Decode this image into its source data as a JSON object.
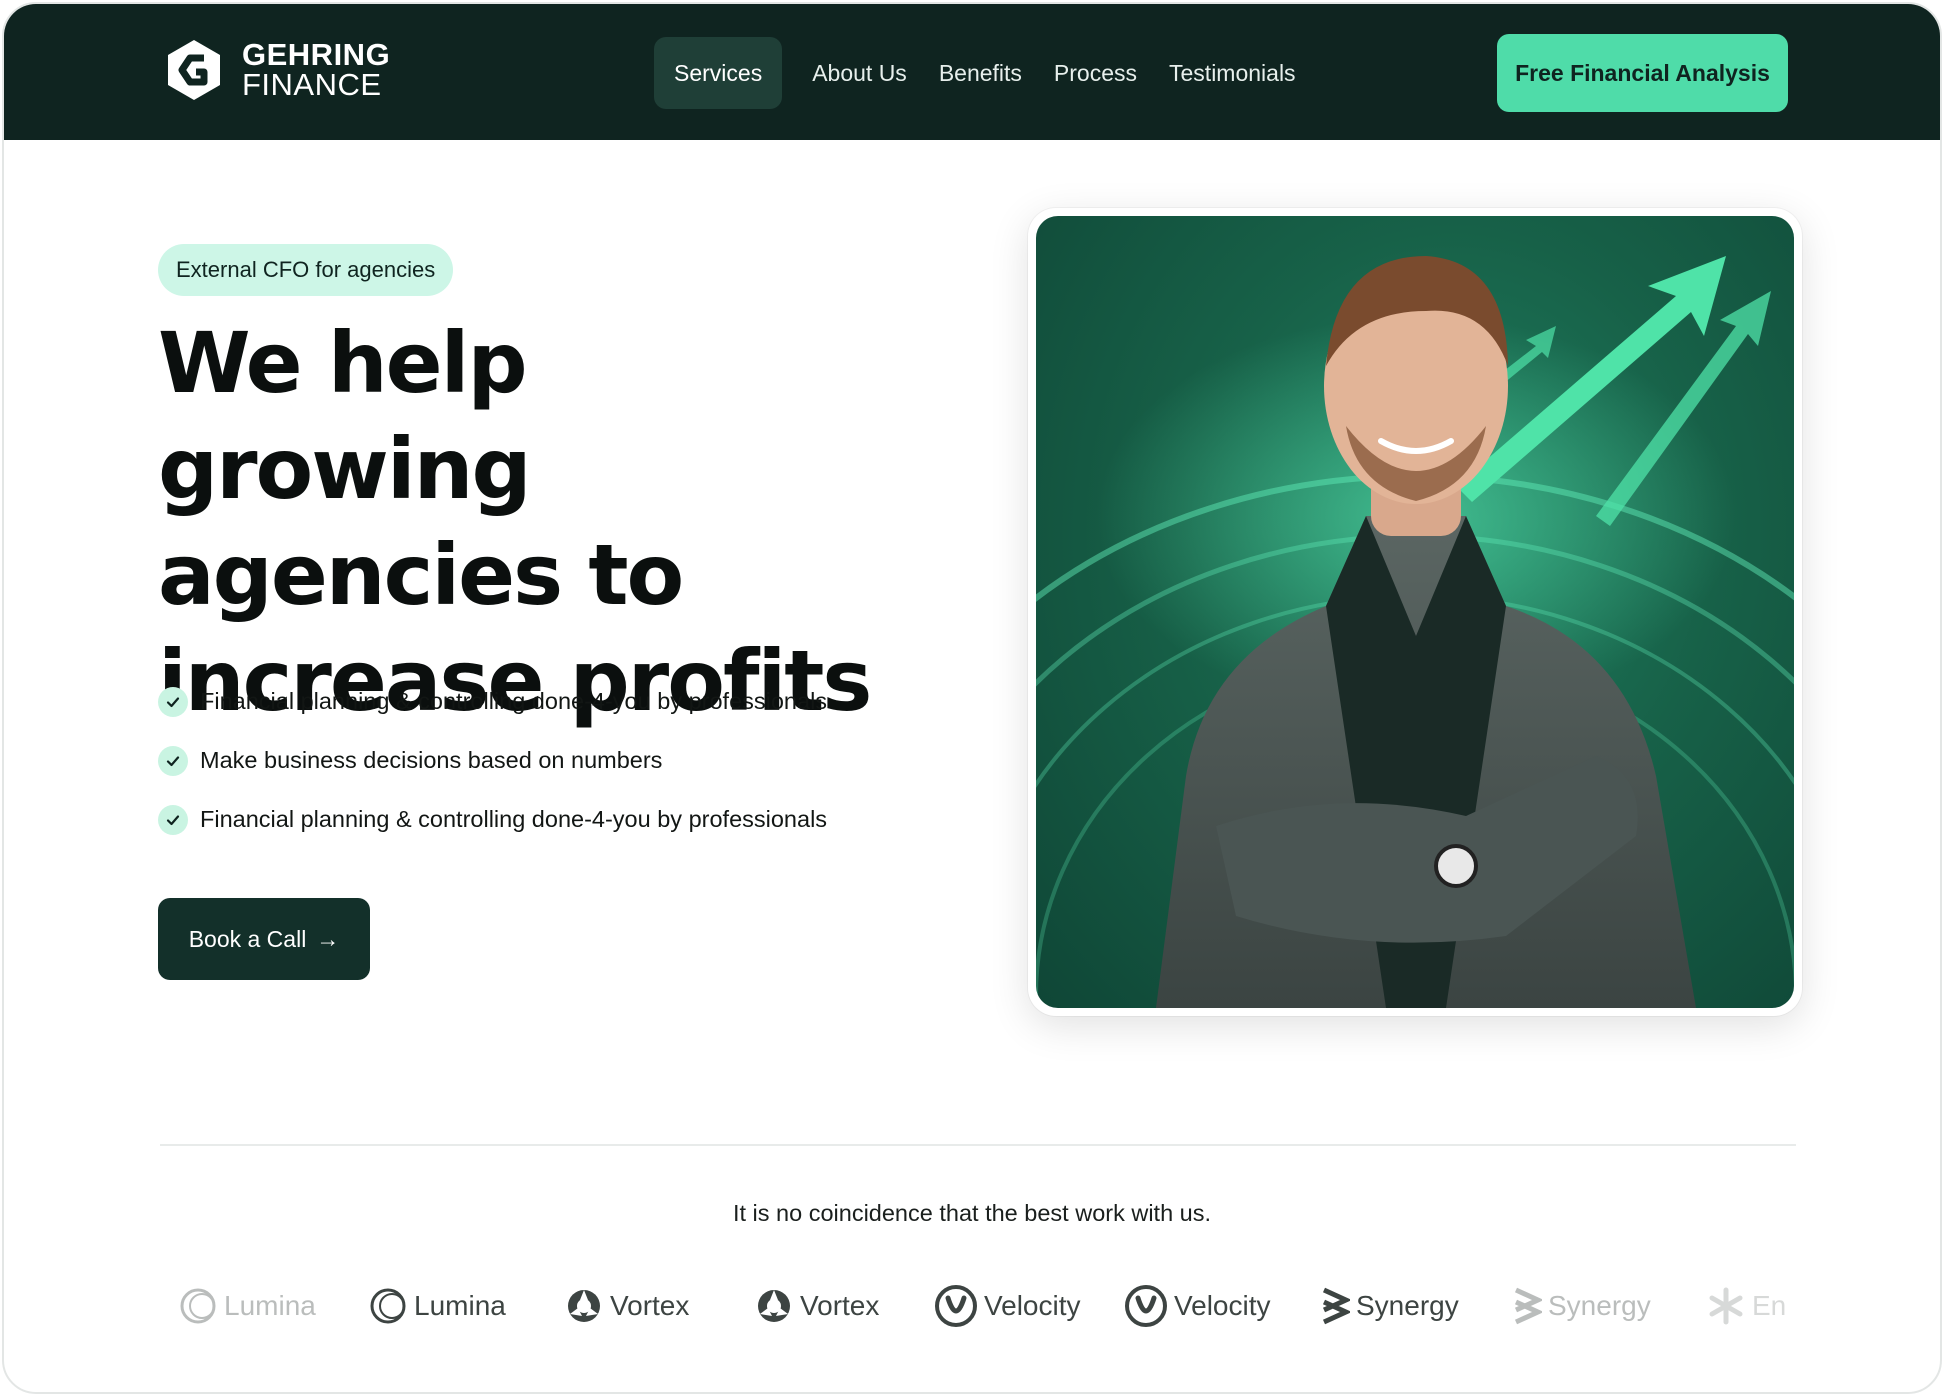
{
  "brand": {
    "name_line1": "GEHRING",
    "name_line2": "FINANCE"
  },
  "nav": {
    "items": [
      {
        "label": "Services",
        "active": true
      },
      {
        "label": "About Us"
      },
      {
        "label": "Benefits"
      },
      {
        "label": "Process"
      },
      {
        "label": "Testimonials"
      }
    ],
    "cta_label": "Free Financial Analysis"
  },
  "hero": {
    "badge": "External CFO for agencies",
    "headline_line1": "We help growing",
    "headline_line2": "agencies to",
    "headline_line3": "increase profits",
    "features": [
      "Financial planning & controlling done-4-you by professionals",
      "Make business decisions based on numbers",
      "Financial planning & controlling done-4-you by professionals"
    ],
    "book_label": "Book a Call",
    "arrow_glyph": "→"
  },
  "social_proof": {
    "tagline": "It is no coincidence that the best work with us.",
    "logos": [
      "Lumina",
      "Lumina",
      "Vortex",
      "Vortex",
      "Velocity",
      "Velocity",
      "Synergy",
      "Synergy",
      "En"
    ]
  },
  "colors": {
    "nav_bg": "#0f2420",
    "accent": "#4fdca9",
    "badge_bg": "#cdf6e7",
    "button_dark": "#13302a"
  }
}
